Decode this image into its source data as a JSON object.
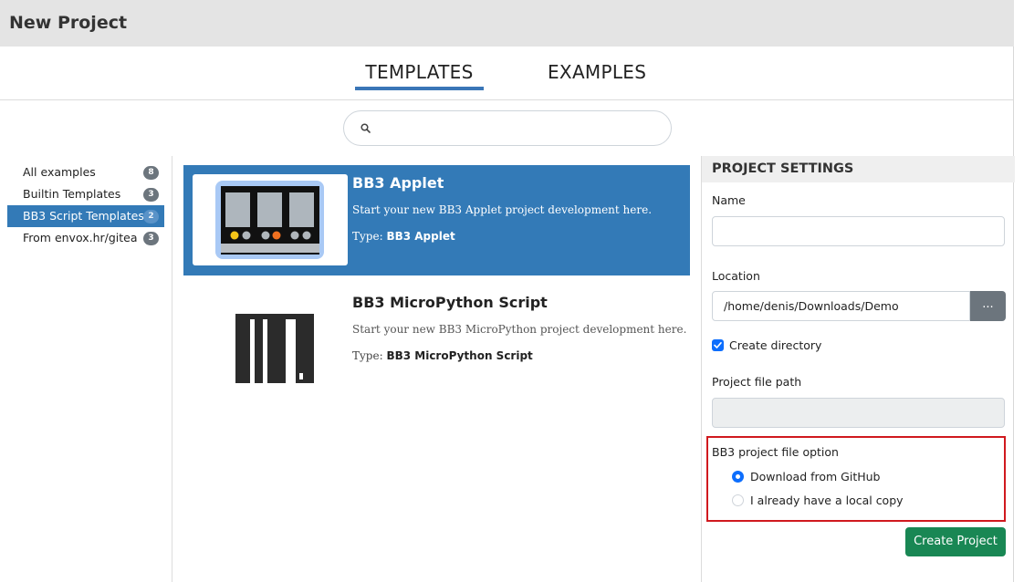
{
  "window": {
    "title": "New Project"
  },
  "tabs": [
    {
      "label": "TEMPLATES",
      "active": true
    },
    {
      "label": "EXAMPLES",
      "active": false
    }
  ],
  "search": {
    "placeholder": "",
    "value": ""
  },
  "sidebar": {
    "items": [
      {
        "label": "All examples",
        "count": "8",
        "active": false
      },
      {
        "label": "Builtin Templates",
        "count": "3",
        "active": false
      },
      {
        "label": "BB3 Script Templates",
        "count": "2",
        "active": true
      },
      {
        "label": "From envox.hr/gitea",
        "count": "3",
        "active": false
      }
    ]
  },
  "templates": [
    {
      "title": "BB3 Applet",
      "description": "Start your new BB3 Applet project development here.",
      "type_prefix": "Type:",
      "type": "BB3 Applet",
      "selected": true,
      "icon": "bb3-device-icon"
    },
    {
      "title": "BB3 MicroPython Script",
      "description": "Start your new BB3 MicroPython project development here.",
      "type_prefix": "Type:",
      "type": "BB3 MicroPython Script",
      "selected": false,
      "icon": "micropython-logo-icon"
    }
  ],
  "settings": {
    "header": "PROJECT SETTINGS",
    "name_label": "Name",
    "name_value": "",
    "location_label": "Location",
    "location_value": "/home/denis/Downloads/Demo",
    "browse_label": "...",
    "create_directory_label": "Create directory",
    "create_directory_checked": true,
    "project_file_path_label": "Project file path",
    "project_file_path_value": "",
    "file_option": {
      "title": "BB3 project file option",
      "options": [
        {
          "label": "Download from GitHub",
          "selected": true
        },
        {
          "label": "I already have a local copy",
          "selected": false
        }
      ]
    },
    "create_button_label": "Create Project"
  },
  "colors": {
    "accent_blue": "#337ab7",
    "create_green": "#198754",
    "highlight_red": "#d0191e",
    "title_bar": "#e4e4e4"
  }
}
